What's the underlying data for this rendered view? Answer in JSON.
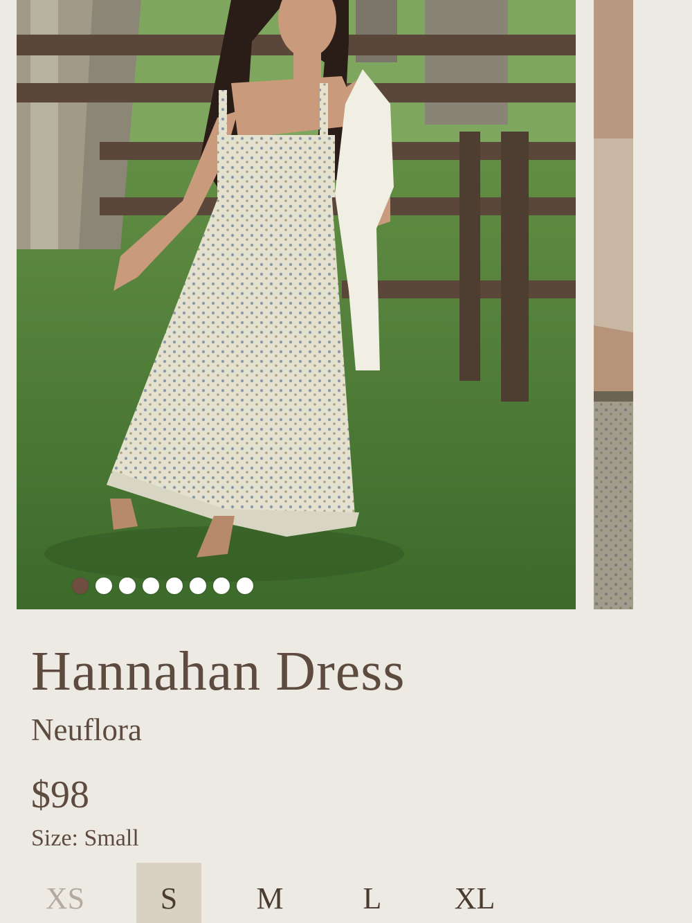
{
  "gallery": {
    "main_image_alt": "Model wearing floral maxi dress in grassy field by wooden fence",
    "slide_count": 8,
    "active_slide": 1,
    "dots": [
      {
        "label": "1"
      },
      {
        "label": "2"
      },
      {
        "label": "3"
      },
      {
        "label": "4"
      },
      {
        "label": "5"
      },
      {
        "label": "6"
      },
      {
        "label": "7"
      },
      {
        "label": "8"
      }
    ]
  },
  "product": {
    "title": "Hannahan Dress",
    "brand": "Neuflora",
    "price": "$98",
    "size_label": "Size:",
    "size_value": "Small"
  },
  "sizes": {
    "options": [
      {
        "label": "XS",
        "state": "unavailable"
      },
      {
        "label": "S",
        "state": "selected"
      },
      {
        "label": "M",
        "state": "available"
      },
      {
        "label": "L",
        "state": "available"
      },
      {
        "label": "XL",
        "state": "available"
      }
    ]
  },
  "colors": {
    "background": "#edeae3",
    "text": "#5e4b3f",
    "selected_size_bg": "#d9d1c2",
    "active_dot": "#6f4e40",
    "inactive_dot": "#ffffff"
  }
}
